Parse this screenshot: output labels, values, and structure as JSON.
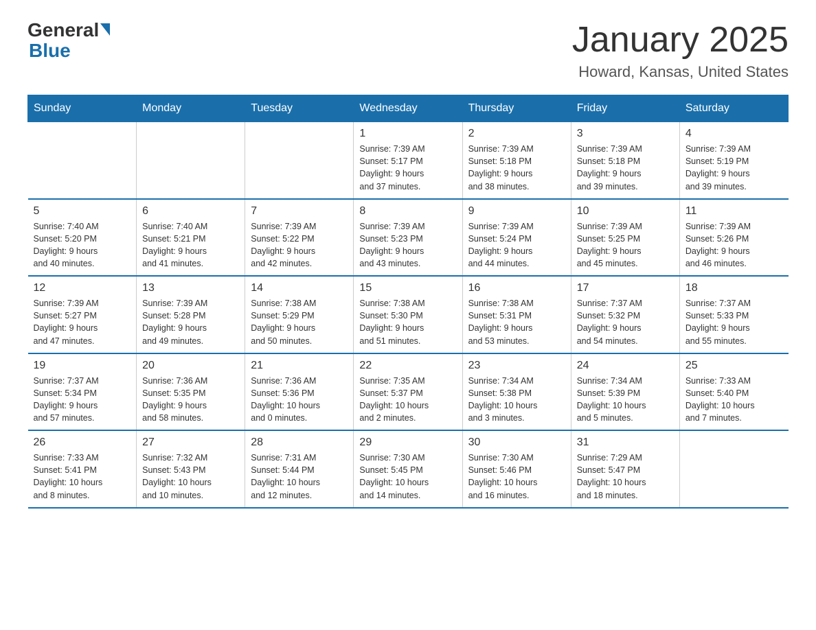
{
  "logo": {
    "general": "General",
    "blue": "Blue"
  },
  "title": "January 2025",
  "subtitle": "Howard, Kansas, United States",
  "days_of_week": [
    "Sunday",
    "Monday",
    "Tuesday",
    "Wednesday",
    "Thursday",
    "Friday",
    "Saturday"
  ],
  "weeks": [
    [
      {
        "day": "",
        "info": ""
      },
      {
        "day": "",
        "info": ""
      },
      {
        "day": "",
        "info": ""
      },
      {
        "day": "1",
        "info": "Sunrise: 7:39 AM\nSunset: 5:17 PM\nDaylight: 9 hours\nand 37 minutes."
      },
      {
        "day": "2",
        "info": "Sunrise: 7:39 AM\nSunset: 5:18 PM\nDaylight: 9 hours\nand 38 minutes."
      },
      {
        "day": "3",
        "info": "Sunrise: 7:39 AM\nSunset: 5:18 PM\nDaylight: 9 hours\nand 39 minutes."
      },
      {
        "day": "4",
        "info": "Sunrise: 7:39 AM\nSunset: 5:19 PM\nDaylight: 9 hours\nand 39 minutes."
      }
    ],
    [
      {
        "day": "5",
        "info": "Sunrise: 7:40 AM\nSunset: 5:20 PM\nDaylight: 9 hours\nand 40 minutes."
      },
      {
        "day": "6",
        "info": "Sunrise: 7:40 AM\nSunset: 5:21 PM\nDaylight: 9 hours\nand 41 minutes."
      },
      {
        "day": "7",
        "info": "Sunrise: 7:39 AM\nSunset: 5:22 PM\nDaylight: 9 hours\nand 42 minutes."
      },
      {
        "day": "8",
        "info": "Sunrise: 7:39 AM\nSunset: 5:23 PM\nDaylight: 9 hours\nand 43 minutes."
      },
      {
        "day": "9",
        "info": "Sunrise: 7:39 AM\nSunset: 5:24 PM\nDaylight: 9 hours\nand 44 minutes."
      },
      {
        "day": "10",
        "info": "Sunrise: 7:39 AM\nSunset: 5:25 PM\nDaylight: 9 hours\nand 45 minutes."
      },
      {
        "day": "11",
        "info": "Sunrise: 7:39 AM\nSunset: 5:26 PM\nDaylight: 9 hours\nand 46 minutes."
      }
    ],
    [
      {
        "day": "12",
        "info": "Sunrise: 7:39 AM\nSunset: 5:27 PM\nDaylight: 9 hours\nand 47 minutes."
      },
      {
        "day": "13",
        "info": "Sunrise: 7:39 AM\nSunset: 5:28 PM\nDaylight: 9 hours\nand 49 minutes."
      },
      {
        "day": "14",
        "info": "Sunrise: 7:38 AM\nSunset: 5:29 PM\nDaylight: 9 hours\nand 50 minutes."
      },
      {
        "day": "15",
        "info": "Sunrise: 7:38 AM\nSunset: 5:30 PM\nDaylight: 9 hours\nand 51 minutes."
      },
      {
        "day": "16",
        "info": "Sunrise: 7:38 AM\nSunset: 5:31 PM\nDaylight: 9 hours\nand 53 minutes."
      },
      {
        "day": "17",
        "info": "Sunrise: 7:37 AM\nSunset: 5:32 PM\nDaylight: 9 hours\nand 54 minutes."
      },
      {
        "day": "18",
        "info": "Sunrise: 7:37 AM\nSunset: 5:33 PM\nDaylight: 9 hours\nand 55 minutes."
      }
    ],
    [
      {
        "day": "19",
        "info": "Sunrise: 7:37 AM\nSunset: 5:34 PM\nDaylight: 9 hours\nand 57 minutes."
      },
      {
        "day": "20",
        "info": "Sunrise: 7:36 AM\nSunset: 5:35 PM\nDaylight: 9 hours\nand 58 minutes."
      },
      {
        "day": "21",
        "info": "Sunrise: 7:36 AM\nSunset: 5:36 PM\nDaylight: 10 hours\nand 0 minutes."
      },
      {
        "day": "22",
        "info": "Sunrise: 7:35 AM\nSunset: 5:37 PM\nDaylight: 10 hours\nand 2 minutes."
      },
      {
        "day": "23",
        "info": "Sunrise: 7:34 AM\nSunset: 5:38 PM\nDaylight: 10 hours\nand 3 minutes."
      },
      {
        "day": "24",
        "info": "Sunrise: 7:34 AM\nSunset: 5:39 PM\nDaylight: 10 hours\nand 5 minutes."
      },
      {
        "day": "25",
        "info": "Sunrise: 7:33 AM\nSunset: 5:40 PM\nDaylight: 10 hours\nand 7 minutes."
      }
    ],
    [
      {
        "day": "26",
        "info": "Sunrise: 7:33 AM\nSunset: 5:41 PM\nDaylight: 10 hours\nand 8 minutes."
      },
      {
        "day": "27",
        "info": "Sunrise: 7:32 AM\nSunset: 5:43 PM\nDaylight: 10 hours\nand 10 minutes."
      },
      {
        "day": "28",
        "info": "Sunrise: 7:31 AM\nSunset: 5:44 PM\nDaylight: 10 hours\nand 12 minutes."
      },
      {
        "day": "29",
        "info": "Sunrise: 7:30 AM\nSunset: 5:45 PM\nDaylight: 10 hours\nand 14 minutes."
      },
      {
        "day": "30",
        "info": "Sunrise: 7:30 AM\nSunset: 5:46 PM\nDaylight: 10 hours\nand 16 minutes."
      },
      {
        "day": "31",
        "info": "Sunrise: 7:29 AM\nSunset: 5:47 PM\nDaylight: 10 hours\nand 18 minutes."
      },
      {
        "day": "",
        "info": ""
      }
    ]
  ]
}
